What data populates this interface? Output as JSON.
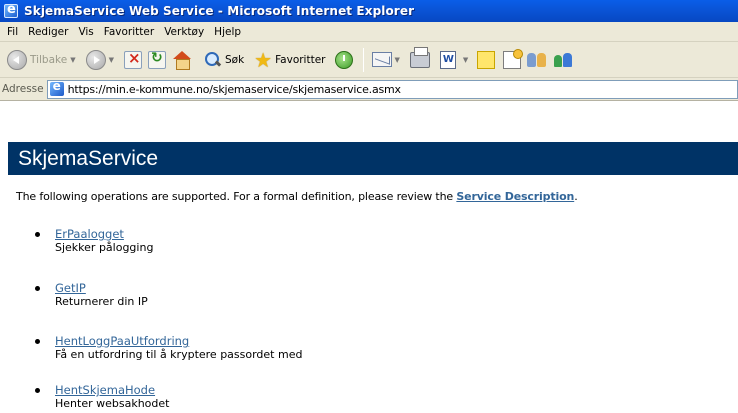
{
  "window": {
    "title": "SkjemaService Web Service - Microsoft Internet Explorer"
  },
  "menu": {
    "items": [
      "Fil",
      "Rediger",
      "Vis",
      "Favoritter",
      "Verktøy",
      "Hjelp"
    ]
  },
  "toolbar": {
    "back_label": "Tilbake",
    "search_label": "Søk",
    "favorites_label": "Favoritter"
  },
  "address": {
    "label": "Adresse",
    "url": "https://min.e-kommune.no/skjemaservice/skjemaservice.asmx"
  },
  "page": {
    "heading": "SkjemaService",
    "intro_prefix": "The following operations are supported. For a formal definition, please review the ",
    "intro_link": "Service Description",
    "intro_suffix": ".",
    "operations": [
      {
        "name": "ErPaalogget",
        "description": "Sjekker pålogging"
      },
      {
        "name": "GetIP",
        "description": "Returnerer din IP"
      },
      {
        "name": "HentLoggPaaUtfordring",
        "description": "Få en utfordring til å kryptere passordet med"
      },
      {
        "name": "HentSkjemaHode",
        "description": "Henter websakhodet"
      }
    ]
  }
}
